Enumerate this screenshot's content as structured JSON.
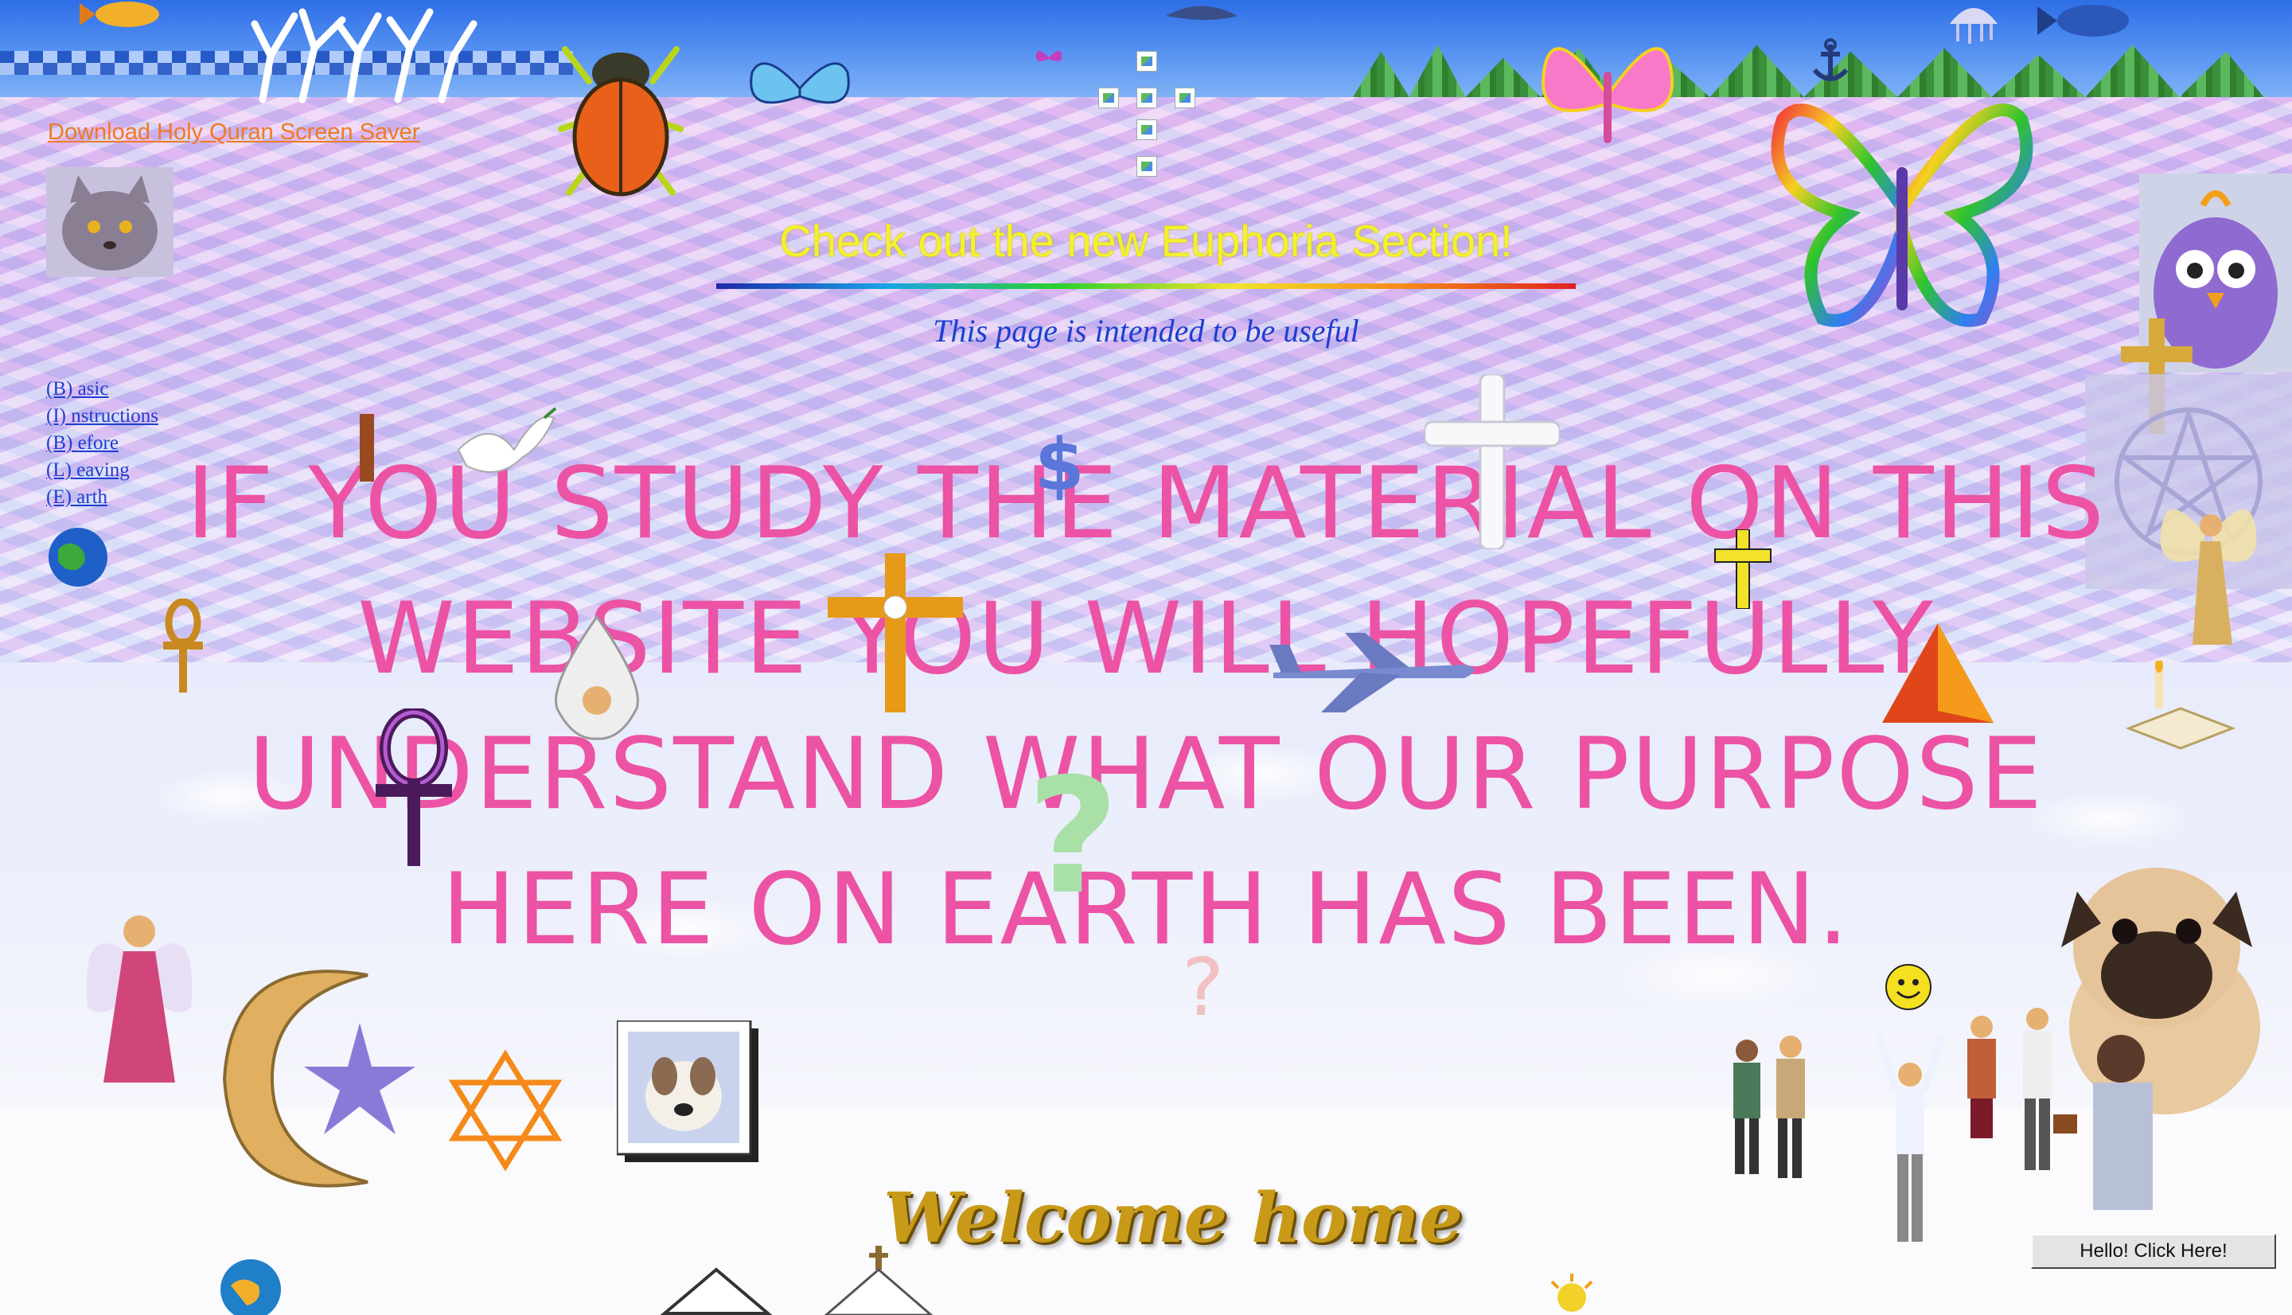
{
  "header": {
    "download_link": "Download Holy Quran Screen Saver",
    "euphoria_link": "Check out the new Euphoria Section!",
    "tagline": "This page is intended to be useful"
  },
  "nav": {
    "items": [
      {
        "label": "(B) asic"
      },
      {
        "label": "(I) nstructions"
      },
      {
        "label": "(B) efore"
      },
      {
        "label": "(L) eaving"
      },
      {
        "label": "(E) arth"
      }
    ]
  },
  "headline": "IF YOU STUDY THE MATERIAL ON THIS WEBSITE YOU WILL HOPEFULLY UNDERSTAND WHAT OUR PURPOSE HERE ON EARTH HAS BEEN.",
  "footer": {
    "welcome_banner": "Welcome home",
    "hello_button": "Hello!  Click Here!"
  },
  "colors": {
    "headline": "#ec53a4",
    "euphoria": "#f2f22a",
    "download_link": "#f07a22",
    "nav_link": "#1c3fd0"
  },
  "icons": [
    "coral-icon",
    "scarab-beetle-icon",
    "butterfly-icon",
    "cross-icon",
    "dove-icon",
    "dollar-icon",
    "airplane-icon",
    "ankh-icon",
    "question-mark-icon",
    "crescent-star-icon",
    "star-of-david-icon",
    "globe-icon",
    "angel-icon",
    "fairy-icon",
    "pyramid-icon",
    "smiley-icon",
    "pug-dog-icon",
    "business-people-icon",
    "persian-cat-icon",
    "furby-icon",
    "dog-photo-icon",
    "fish-icon",
    "anchor-icon"
  ]
}
